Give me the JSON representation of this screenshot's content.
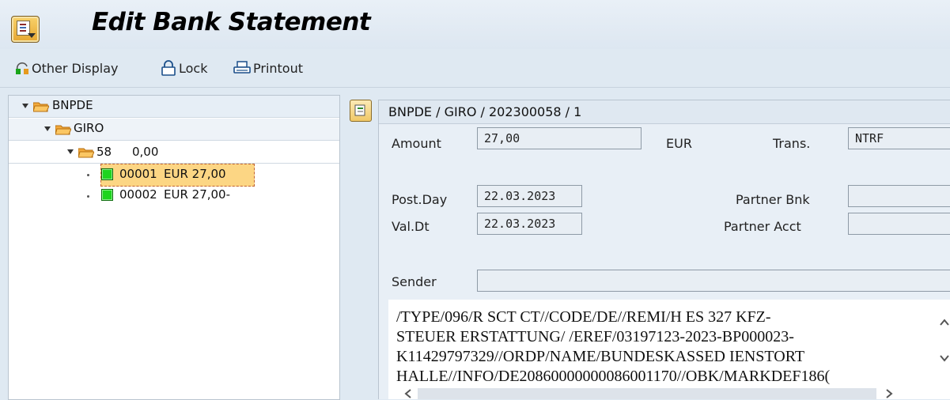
{
  "title": "Edit Bank Statement",
  "toolbar": {
    "other_display": "Other Display",
    "lock": "Lock",
    "printout": "Printout"
  },
  "tree": {
    "root": "BNPDE",
    "account": "GIRO",
    "statement_no": "58",
    "statement_amount": "0,00",
    "items": [
      {
        "id": "00001",
        "text": "EUR 27,00",
        "status": "green",
        "selected": true
      },
      {
        "id": "00002",
        "text": "EUR 27,00-",
        "status": "green",
        "selected": false
      }
    ]
  },
  "detail": {
    "header": "BNPDE / GIRO / 202300058 / 1",
    "amount_label": "Amount",
    "amount_value": "27,00",
    "currency": "EUR",
    "trans_label": "Trans.",
    "trans_value": "NTRF",
    "postday_label": "Post.Day",
    "postday_value": "22.03.2023",
    "valdt_label": "Val.Dt",
    "valdt_value": "22.03.2023",
    "partner_bnk_label": "Partner Bnk",
    "partner_bnk_value": "",
    "partner_acct_label": "Partner Acct",
    "partner_acct_value": "",
    "sender_label": "Sender",
    "sender_value": "",
    "note_lines": [
      "/TYPE/096/R SCT CT//CODE/DE//REMI/H ES 327 KFZ-",
      "STEUER ERSTATTUNG/ /EREF/03197123-2023-BP000023-",
      "K11429797329//ORDP/NAME/BUNDESKASSED IENSTORT",
      "HALLE//INFO/DE20860000000086001170//OBK/MARKDEF186("
    ]
  },
  "colors": {
    "background": "#dfe9f2",
    "selected_row": "#fcd684",
    "status_green": "#1ed41e",
    "folder": "#f2a93b"
  }
}
